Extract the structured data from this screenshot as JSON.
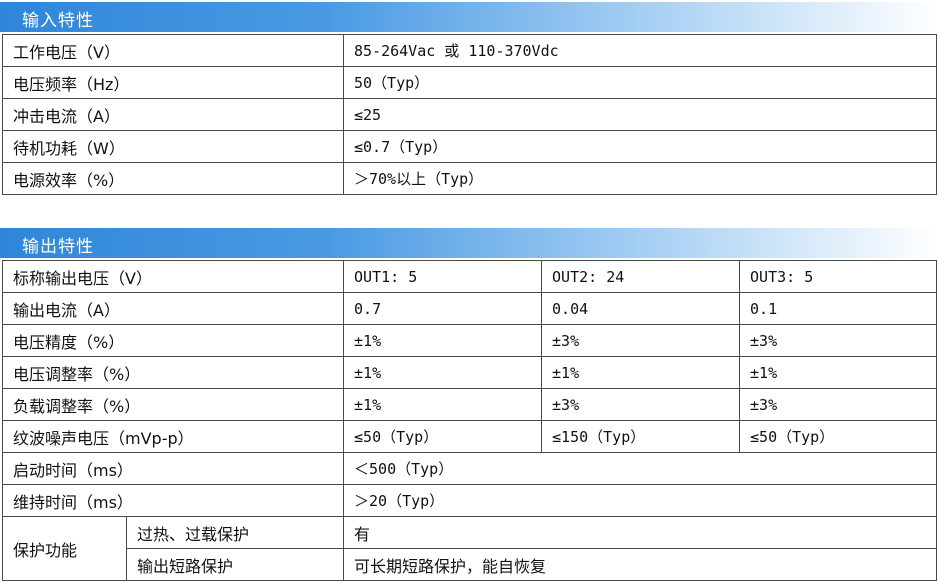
{
  "input": {
    "section_title": "输入特性",
    "rows": [
      {
        "label": "工作电压（V）",
        "value": "85-264Vac 或 110-370Vdc"
      },
      {
        "label": "电压频率（Hz）",
        "value": "50（Typ）"
      },
      {
        "label": "冲击电流（A）",
        "value": "≤25"
      },
      {
        "label": "待机功耗（W）",
        "value": "≤0.7（Typ）"
      },
      {
        "label": "电源效率（%）",
        "value": "＞70%以上（Typ）"
      }
    ]
  },
  "output": {
    "section_title": "输出特性",
    "multi_rows": [
      {
        "label": "标称输出电压（V）",
        "values": [
          "OUT1: 5",
          "OUT2: 24",
          "OUT3: 5"
        ]
      },
      {
        "label": "输出电流（A）",
        "values": [
          "0.7",
          "0.04",
          "0.1"
        ]
      },
      {
        "label": "电压精度（%）",
        "values": [
          "±1%",
          "±3%",
          "±3%"
        ]
      },
      {
        "label": "电压调整率（%）",
        "values": [
          "±1%",
          "±1%",
          "±1%"
        ]
      },
      {
        "label": "负载调整率（%）",
        "values": [
          "±1%",
          "±3%",
          "±3%"
        ]
      },
      {
        "label": "纹波噪声电压（mVp-p）",
        "values": [
          "≤50（Typ）",
          "≤150（Typ）",
          "≤50（Typ）"
        ]
      }
    ],
    "single_rows": [
      {
        "label": "启动时间（ms）",
        "value": "＜500（Typ）"
      },
      {
        "label": "维持时间（ms）",
        "value": "＞20（Typ）"
      }
    ],
    "protection": {
      "label": "保护功能",
      "items": [
        {
          "name": "过热、过载保护",
          "value": "有"
        },
        {
          "name": "输出短路保护",
          "value": "可长期短路保护，能自恢复"
        }
      ]
    }
  }
}
